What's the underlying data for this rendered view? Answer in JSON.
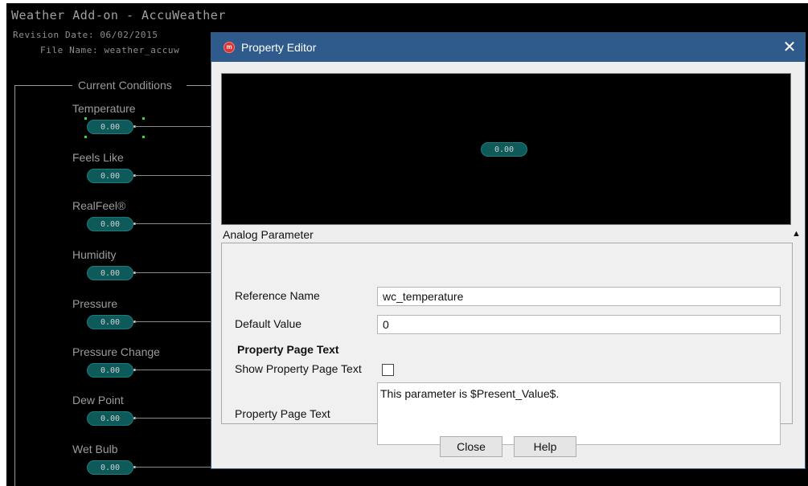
{
  "background": {
    "title": "Weather Add-on - AccuWeather",
    "revision": "Revision Date: 06/02/2015",
    "file_name": "File Name: weather_accuw",
    "group_label": "Current Conditions",
    "params": [
      {
        "label": "Temperature",
        "value": "0.00"
      },
      {
        "label": "Feels Like",
        "value": "0.00"
      },
      {
        "label": "RealFeel®",
        "value": "0.00"
      },
      {
        "label": "Humidity",
        "value": "0.00"
      },
      {
        "label": "Pressure",
        "value": "0.00"
      },
      {
        "label": "Pressure Change",
        "value": "0.00"
      },
      {
        "label": "Dew Point",
        "value": "0.00"
      },
      {
        "label": "Wet Bulb",
        "value": "0.00"
      }
    ]
  },
  "dialog": {
    "title": "Property Editor",
    "close_glyph": "✕",
    "icon_text": "m",
    "preview_value": "0.00",
    "section_label": "Analog Parameter",
    "collapse_glyph": "▲",
    "fields": {
      "reference_name_label": "Reference Name",
      "reference_name_value": "wc_temperature",
      "default_value_label": "Default Value",
      "default_value_value": "0",
      "page_text_heading": "Property Page Text",
      "show_page_text_label": "Show Property Page Text",
      "show_page_text_checked": false,
      "page_text_label": "Property Page Text",
      "page_text_value": "This parameter is $Present_Value$."
    },
    "buttons": {
      "close": "Close",
      "help": "Help"
    }
  }
}
